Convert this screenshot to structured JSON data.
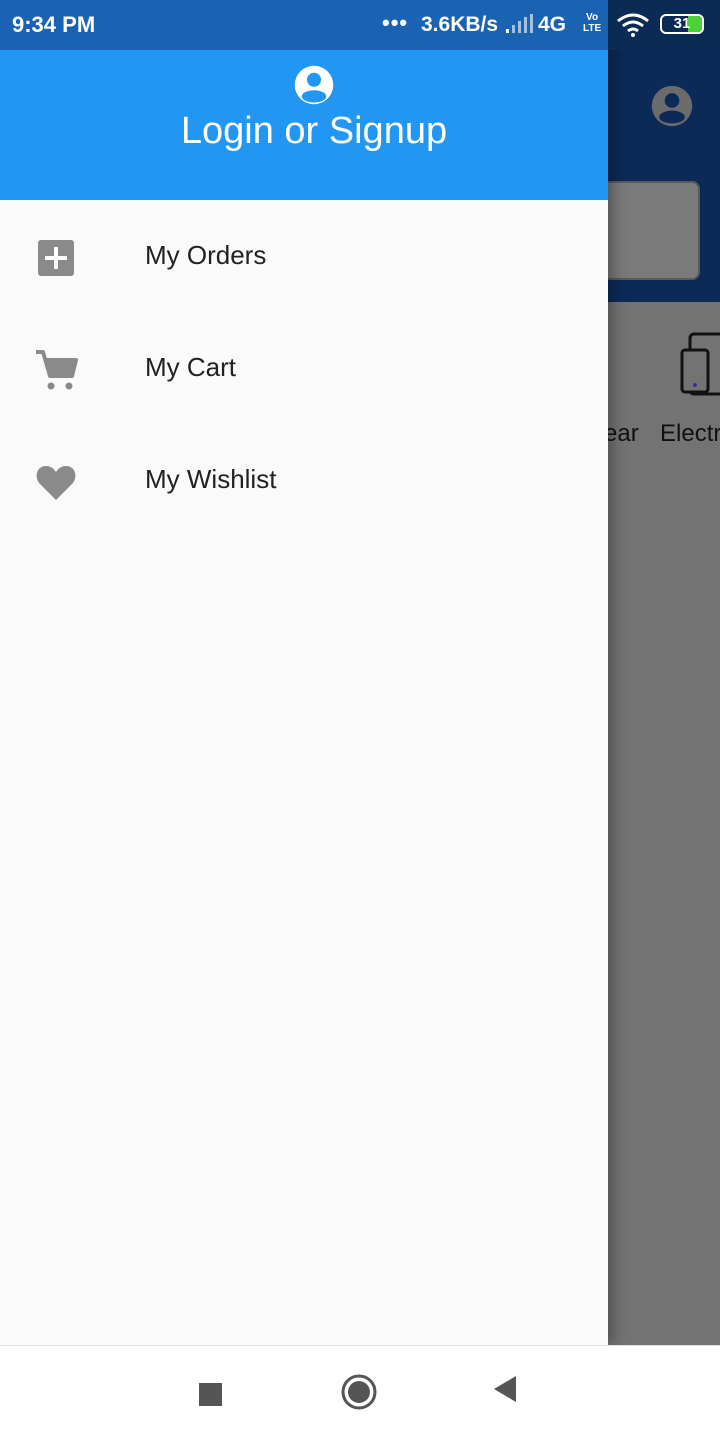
{
  "status_bar": {
    "time": "9:34 PM",
    "dots": "•••",
    "speed": "3.6KB/s",
    "network": "4G",
    "volte_top": "Vo",
    "volte_bottom": "LTE",
    "battery": "31"
  },
  "drawer": {
    "header": {
      "title": "Login or Signup",
      "icon": "account-circle-icon"
    },
    "items": [
      {
        "label": "My Orders",
        "icon": "add-box-icon"
      },
      {
        "label": "My Cart",
        "icon": "shopping-cart-icon"
      },
      {
        "label": "My Wishlist",
        "icon": "heart-icon"
      }
    ]
  },
  "background": {
    "category_labels": [
      "ear",
      "Electr"
    ],
    "avatar_icon": "account-circle-icon"
  },
  "nav_bar": {
    "recents_icon": "square-icon",
    "home_icon": "circle-icon",
    "back_icon": "triangle-back-icon"
  },
  "colors": {
    "drawer_header": "#2196f3",
    "status_bar": "#1a63b3",
    "app_bar_dimmed": "#0c2a57",
    "scrim": "#737373",
    "icon_gray": "#8a8a8a",
    "battery_green": "#4cd137"
  }
}
